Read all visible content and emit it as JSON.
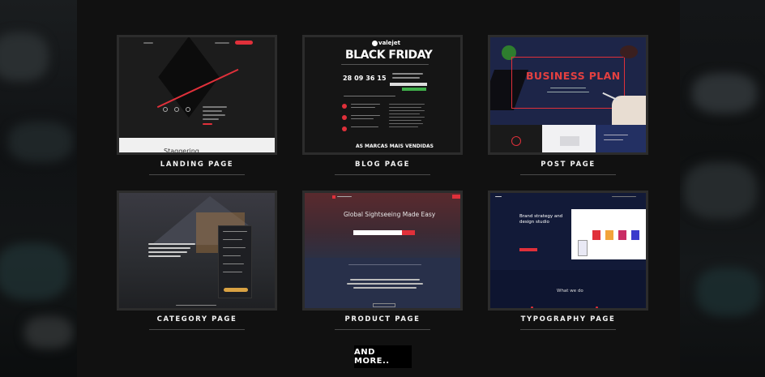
{
  "cards": [
    {
      "label": "LANDING PAGE",
      "preview": {
        "heading": "Staggering"
      }
    },
    {
      "label": "BLOG PAGE",
      "preview": {
        "brand": "valejet",
        "headline": "BLACK FRIDAY",
        "countdown": [
          "28",
          "09",
          "36",
          "15"
        ],
        "footer": "AS MARCAS MAIS VENDIDAS"
      }
    },
    {
      "label": "POST PAGE",
      "preview": {
        "headline": "BUSINESS PLAN"
      }
    },
    {
      "label": "CATEGORY PAGE",
      "preview": {}
    },
    {
      "label": "PRODUCT PAGE",
      "preview": {
        "headline": "Global Sightseeing Made Easy"
      }
    },
    {
      "label": "TYPOGRAPHY PAGE",
      "preview": {
        "headline": "Brand strategy and design studio",
        "section": "What we do"
      }
    }
  ],
  "more_button": {
    "label": "AND MORE.."
  },
  "colors": {
    "background": "#121212",
    "accent_red": "#e0303a",
    "card_border": "#2c2c2c"
  }
}
